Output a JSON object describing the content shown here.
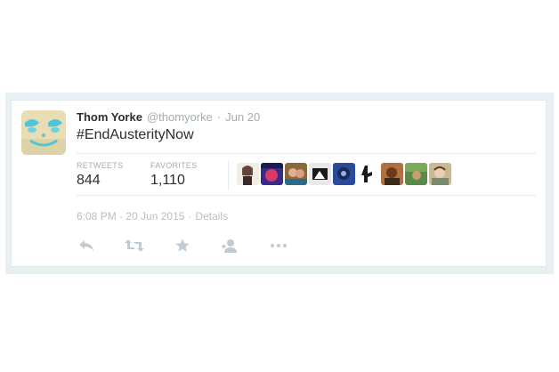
{
  "tweet": {
    "fullname": "Thom Yorke",
    "username": "@thomyorke",
    "separator": "·",
    "time_ago": "Jun 20",
    "text": "#EndAusterityNow",
    "stats": {
      "retweets_label": "RETWEETS",
      "retweets_value": "844",
      "favorites_label": "FAVORITES",
      "favorites_value": "1,110"
    },
    "timestamp_full": "6:08 PM - 20 Jun 2015",
    "meta_separator": "·",
    "details_link": "Details",
    "favoriter_avatars": [
      {
        "name": "favoriter-avatar-1",
        "color": "#c9a79a"
      },
      {
        "name": "favoriter-avatar-2",
        "color": "#3a2a8a"
      },
      {
        "name": "favoriter-avatar-3",
        "color": "#8a6a3a"
      },
      {
        "name": "favoriter-avatar-4",
        "color": "#e8e8e8"
      },
      {
        "name": "favoriter-avatar-5",
        "color": "#2a4a9a"
      },
      {
        "name": "favoriter-avatar-6",
        "color": "#ffffff"
      },
      {
        "name": "favoriter-avatar-7",
        "color": "#b07040"
      },
      {
        "name": "favoriter-avatar-8",
        "color": "#5a8a4a"
      },
      {
        "name": "favoriter-avatar-9",
        "color": "#c8b898"
      }
    ],
    "actions": [
      "reply-icon",
      "retweet-icon",
      "favorite-icon",
      "follow-icon",
      "more-icon"
    ]
  },
  "colors": {
    "text_primary": "#292f33",
    "text_muted": "#a2adb4",
    "icon_muted": "#c2cbd1",
    "border": "#e1e8ed",
    "frame_bg": "#e9f0f4",
    "avatar_bg": "#e8ddb5",
    "avatar_accent": "#4fc6d8"
  }
}
